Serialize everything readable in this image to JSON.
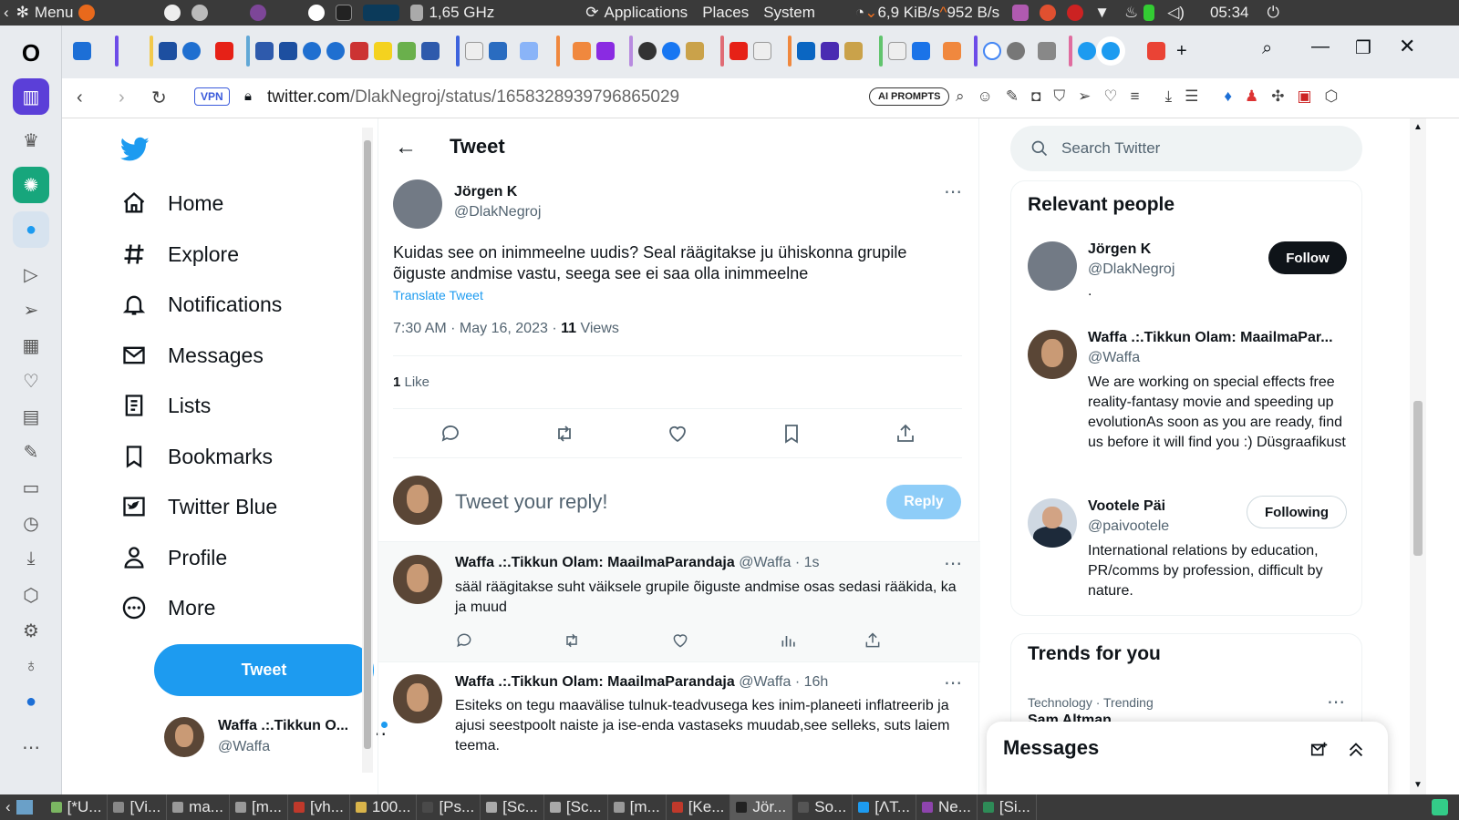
{
  "topbar": {
    "menu": "Menu",
    "cpu": "1,65 GHz",
    "applications": "Applications",
    "places": "Places",
    "system": "System",
    "net_down": "6,9 KiB/s",
    "net_up": "952 B/s",
    "clock": "05:34"
  },
  "browser": {
    "vpn": "VPN",
    "url_host": "twitter.com",
    "url_path": "/DlakNegroj/status/1658328939796865029",
    "ai_prompts": "AI PROMPTS"
  },
  "nav": {
    "items": [
      {
        "label": "Home",
        "icon": "home-icon"
      },
      {
        "label": "Explore",
        "icon": "hashtag-icon"
      },
      {
        "label": "Notifications",
        "icon": "bell-icon"
      },
      {
        "label": "Messages",
        "icon": "mail-icon"
      },
      {
        "label": "Lists",
        "icon": "list-icon"
      },
      {
        "label": "Bookmarks",
        "icon": "bookmark-icon"
      },
      {
        "label": "Twitter Blue",
        "icon": "twitter-blue-icon"
      },
      {
        "label": "Profile",
        "icon": "person-icon"
      },
      {
        "label": "More",
        "icon": "more-circle-icon"
      }
    ],
    "tweet_button": "Tweet",
    "account_name": "Waffa .:.Tikkun O...",
    "account_handle": "@Waffa"
  },
  "main": {
    "header_title": "Tweet",
    "tweet": {
      "name": "Jörgen K",
      "handle": "@DlakNegroj",
      "text": "Kuidas see on inimmeelne uudis? Seal räägitakse ju ühiskonna grupile õiguste andmise vastu, seega see ei saa olla inimmeelne",
      "translate": "Translate Tweet",
      "time": "7:30 AM · May 16, 2023 · ",
      "views_count": "11",
      "views_label": " Views",
      "likes_count": "1",
      "likes_label": " Like"
    },
    "reply_placeholder": "Tweet your reply!",
    "reply_button": "Reply",
    "replies": [
      {
        "name": "Waffa .:.Tikkun Olam: MaailmaParandaja",
        "handle": "@Waffa",
        "time": "· 1s",
        "text": "sääl räägitakse suht väiksele grupile õiguste andmise osas sedasi rääkida, ka ja muud"
      },
      {
        "name": "Waffa .:.Tikkun Olam: MaailmaParandaja",
        "handle": "@Waffa",
        "time": "· 16h",
        "text": "Esiteks on tegu maavälise tulnuk-teadvusega kes inim-planeeti inflatreerib ja ajusi seestpoolt naiste ja ise-enda vastaseks muudab,see selleks, suts laiem teema."
      }
    ]
  },
  "right": {
    "search_placeholder": "Search Twitter",
    "relevant_title": "Relevant people",
    "people": [
      {
        "name": "Jörgen K",
        "handle": "@DlakNegroj",
        "bio": ".",
        "button": "Follow"
      },
      {
        "name": "Waffa .:.Tikkun Olam: MaailmaPar...",
        "handle": "@Waffa",
        "bio": "We are working on special effects free reality-fantasy movie and speeding up evolutionAs soon as you are ready, find us before it will find you :) Düsgraafikust",
        "button": ""
      },
      {
        "name": "Vootele Päi",
        "handle": "@paivootele",
        "bio": "International relations by education, PR/comms by profession, difficult by nature.",
        "button": "Following"
      }
    ],
    "trends_title": "Trends for you",
    "trend_meta": "Technology · Trending",
    "trend_name": "Sam Altman",
    "messages_title": "Messages"
  },
  "taskbar": {
    "tasks": [
      "[*U...",
      "[Vi...",
      "ma...",
      "[m...",
      "[vh...",
      "100...",
      "[Ps...",
      "[Sc...",
      "[Sc...",
      "[m...",
      "[Ke...",
      "Jör...",
      "So...",
      "[ΛT...",
      "Ne...",
      "[Si..."
    ]
  },
  "colors": {
    "accent": "#1d9bf0",
    "text": "#0f1419",
    "muted": "#536471"
  }
}
